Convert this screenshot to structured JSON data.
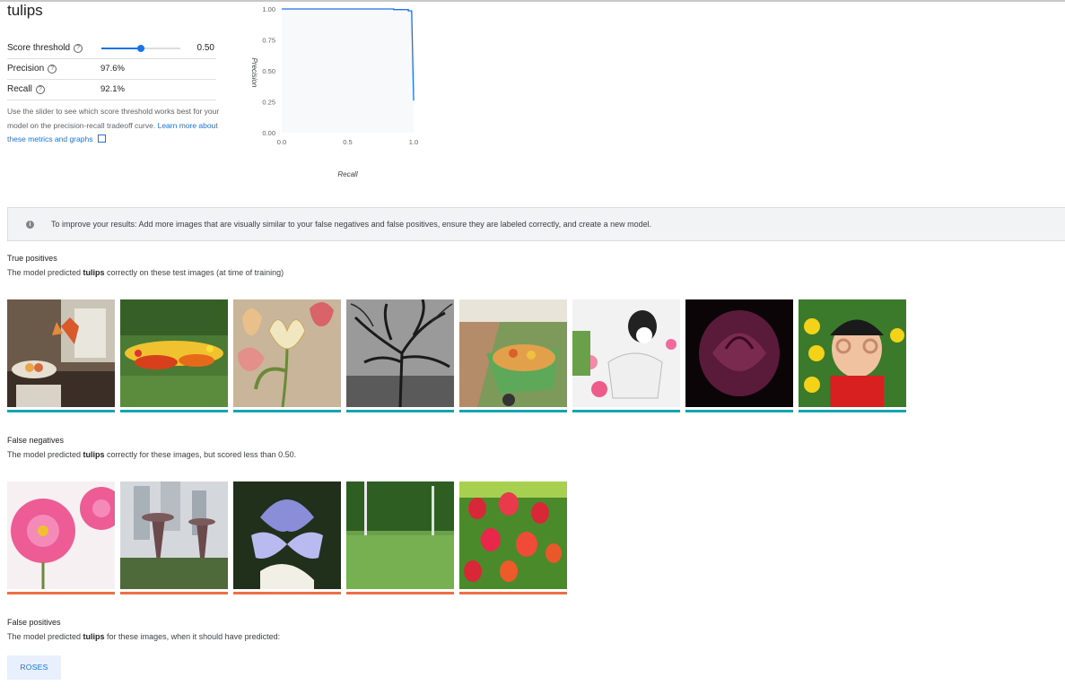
{
  "label_title": "tulips",
  "metrics": {
    "score_threshold_label": "Score threshold",
    "score_threshold_value": "0.50",
    "score_threshold_fraction": 0.5,
    "precision_label": "Precision",
    "precision_value": "97.6%",
    "recall_label": "Recall",
    "recall_value": "92.1%",
    "help_text": "Use the slider to see which score threshold works best for your model on the precision-recall tradeoff curve.",
    "help_link": "Learn more about these metrics and graphs",
    "help_icon": "help-circle-icon",
    "link_icon": "open-in-new-icon"
  },
  "chart_data": {
    "type": "line",
    "title": "",
    "xlabel": "Recall",
    "ylabel": "Precision",
    "xlim": [
      0,
      1
    ],
    "ylim": [
      0,
      1
    ],
    "x_ticks": [
      "0.0",
      "0.5",
      "1.0"
    ],
    "y_ticks": [
      "1.00",
      "0.75",
      "0.50",
      "0.25",
      "0.00"
    ],
    "grid": false,
    "series": [
      {
        "x": [
          0.0,
          0.85,
          0.85,
          0.96,
          0.96,
          0.985,
          0.985,
          1.0
        ],
        "y": [
          1.0,
          1.0,
          0.995,
          0.995,
          0.985,
          0.985,
          0.985,
          0.26
        ]
      }
    ],
    "colors": {
      "line": "#1a73e8",
      "plot_bg": "#f8f9fa"
    }
  },
  "banner": {
    "icon": "info-icon",
    "text": "To improve your results: Add more images that are visually similar to your false negatives and false positives, ensure they are labeled correctly, and create a new model."
  },
  "true_positives": {
    "title": "True positives",
    "desc_pre": "The model predicted ",
    "desc_bold": "tulips",
    "desc_post": " correctly on these test images (at time of training)",
    "images": [
      "room-with-tulips-photo",
      "garden-flowerbeds-photo",
      "tulip-illustration-photo",
      "bare-tree-bw-photo",
      "flower-wheelbarrow-photo",
      "dog-with-tulip-basket-photo",
      "dark-purple-tulip-photo",
      "child-in-tulips-photo"
    ]
  },
  "false_negatives": {
    "title": "False negatives",
    "desc_pre": "The model predicted ",
    "desc_bold": "tulips",
    "desc_post": " correctly for these images, but scored less than 0.50.",
    "images": [
      "pink-peony-tulips-photo",
      "supertree-grove-photo",
      "blue-iris-photo",
      "park-lawn-photo",
      "red-tulip-field-photo"
    ]
  },
  "false_positives": {
    "title": "False positives",
    "desc_pre": "The model predicted ",
    "desc_bold": "tulips",
    "desc_post": " for these images, when it should have predicted:",
    "chip": "ROSES"
  },
  "colors": {
    "accent": "#1a73e8",
    "true_positive_bar": "#12a4af",
    "false_negative_bar": "#ee6e49"
  }
}
